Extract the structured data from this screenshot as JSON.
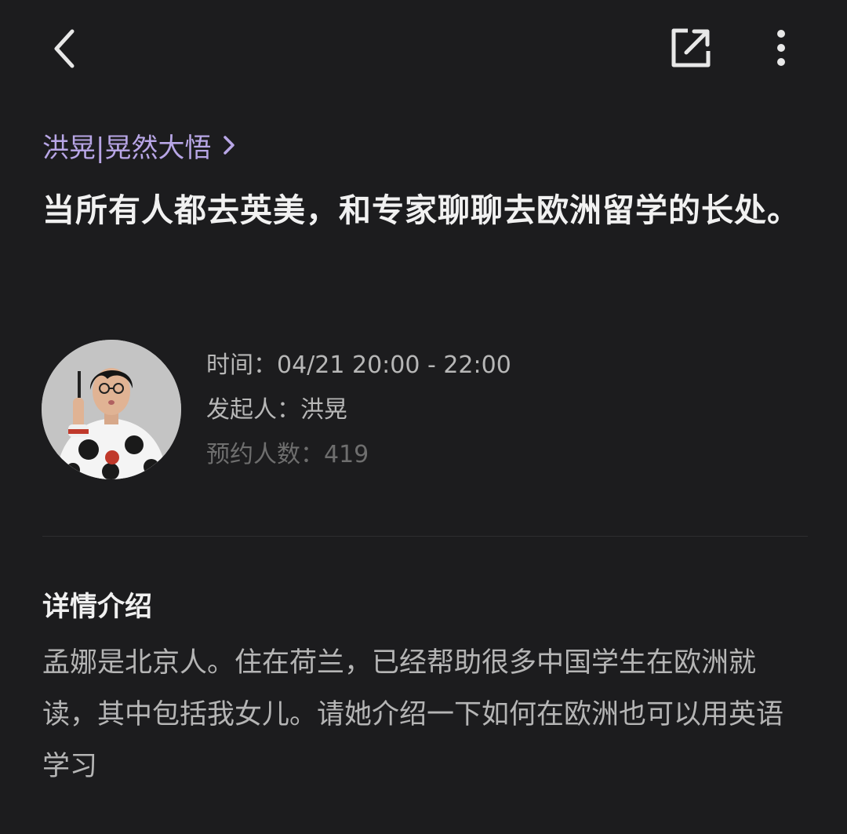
{
  "header": {
    "back_icon": "chevron-left-icon",
    "share_icon": "share-external-icon",
    "more_icon": "more-vertical-icon"
  },
  "author": {
    "label": "洪晃|晃然大悟",
    "chevron_icon": "chevron-right-icon",
    "color": "#b8a6e6"
  },
  "event": {
    "title": "当所有人都去英美，和专家聊聊去欧洲留学的长处。",
    "time_label": "时间：",
    "time_value": "04/21 20:00 - 22:00",
    "host_label": "发起人：",
    "host_value": "洪晃",
    "count_label": "预约人数：",
    "count_value": "419"
  },
  "details": {
    "heading": "详情介绍",
    "body": "孟娜是北京人。住在荷兰，已经帮助很多中国学生在欧洲就读，其中包括我女儿。请她介绍一下如何在欧洲也可以用英语学习"
  }
}
